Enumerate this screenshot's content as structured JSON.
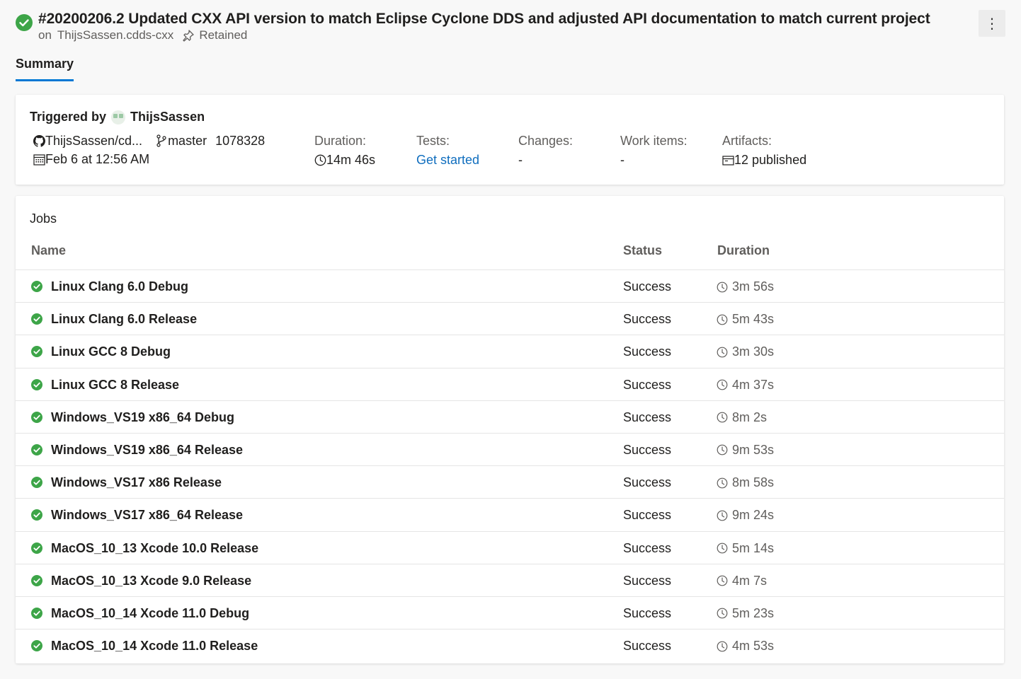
{
  "header": {
    "title": "#20200206.2 Updated CXX API version to match Eclipse Cyclone DDS and adjusted API documentation to match current project",
    "repo_prefix": "on",
    "repo": "ThijsSassen.cdds-cxx",
    "retained": "Retained",
    "more_label": "⋮"
  },
  "tabs": [
    {
      "label": "Summary"
    }
  ],
  "summary": {
    "triggered_by_label": "Triggered by",
    "triggered_by_user": "ThijsSassen",
    "repository": "ThijsSassen/cd...",
    "branch": "master",
    "commit": "1078328",
    "date": "Feb 6 at 12:56 AM",
    "duration_label": "Duration:",
    "duration_value": "14m 46s",
    "tests_label": "Tests:",
    "tests_value": "Get started",
    "changes_label": "Changes:",
    "changes_value": "-",
    "work_items_label": "Work items:",
    "work_items_value": "-",
    "artifacts_label": "Artifacts:",
    "artifacts_value": "12 published"
  },
  "jobs": {
    "title": "Jobs",
    "columns": {
      "name": "Name",
      "status": "Status",
      "duration": "Duration"
    },
    "rows": [
      {
        "name": "Linux Clang 6.0 Debug",
        "status": "Success",
        "duration": "3m 56s"
      },
      {
        "name": "Linux Clang 6.0 Release",
        "status": "Success",
        "duration": "5m 43s"
      },
      {
        "name": "Linux GCC 8 Debug",
        "status": "Success",
        "duration": "3m 30s"
      },
      {
        "name": "Linux GCC 8 Release",
        "status": "Success",
        "duration": "4m 37s"
      },
      {
        "name": "Windows_VS19 x86_64 Debug",
        "status": "Success",
        "duration": "8m 2s"
      },
      {
        "name": "Windows_VS19 x86_64 Release",
        "status": "Success",
        "duration": "9m 53s"
      },
      {
        "name": "Windows_VS17 x86 Release",
        "status": "Success",
        "duration": "8m 58s"
      },
      {
        "name": "Windows_VS17 x86_64 Release",
        "status": "Success",
        "duration": "9m 24s"
      },
      {
        "name": "MacOS_10_13 Xcode 10.0 Release",
        "status": "Success",
        "duration": "5m 14s"
      },
      {
        "name": "MacOS_10_13 Xcode 9.0 Release",
        "status": "Success",
        "duration": "4m 7s"
      },
      {
        "name": "MacOS_10_14 Xcode 11.0 Debug",
        "status": "Success",
        "duration": "5m 23s"
      },
      {
        "name": "MacOS_10_14 Xcode 11.0 Release",
        "status": "Success",
        "duration": "4m 53s"
      }
    ]
  },
  "colors": {
    "success": "#3da548",
    "link": "#106ebe",
    "accent": "#0078d4"
  },
  "icons": {
    "status": "check-circle-icon",
    "pin": "pin-icon",
    "repo": "github-icon",
    "branch": "branch-icon",
    "calendar": "calendar-icon",
    "clock": "clock-icon",
    "artifact": "artifact-icon"
  }
}
